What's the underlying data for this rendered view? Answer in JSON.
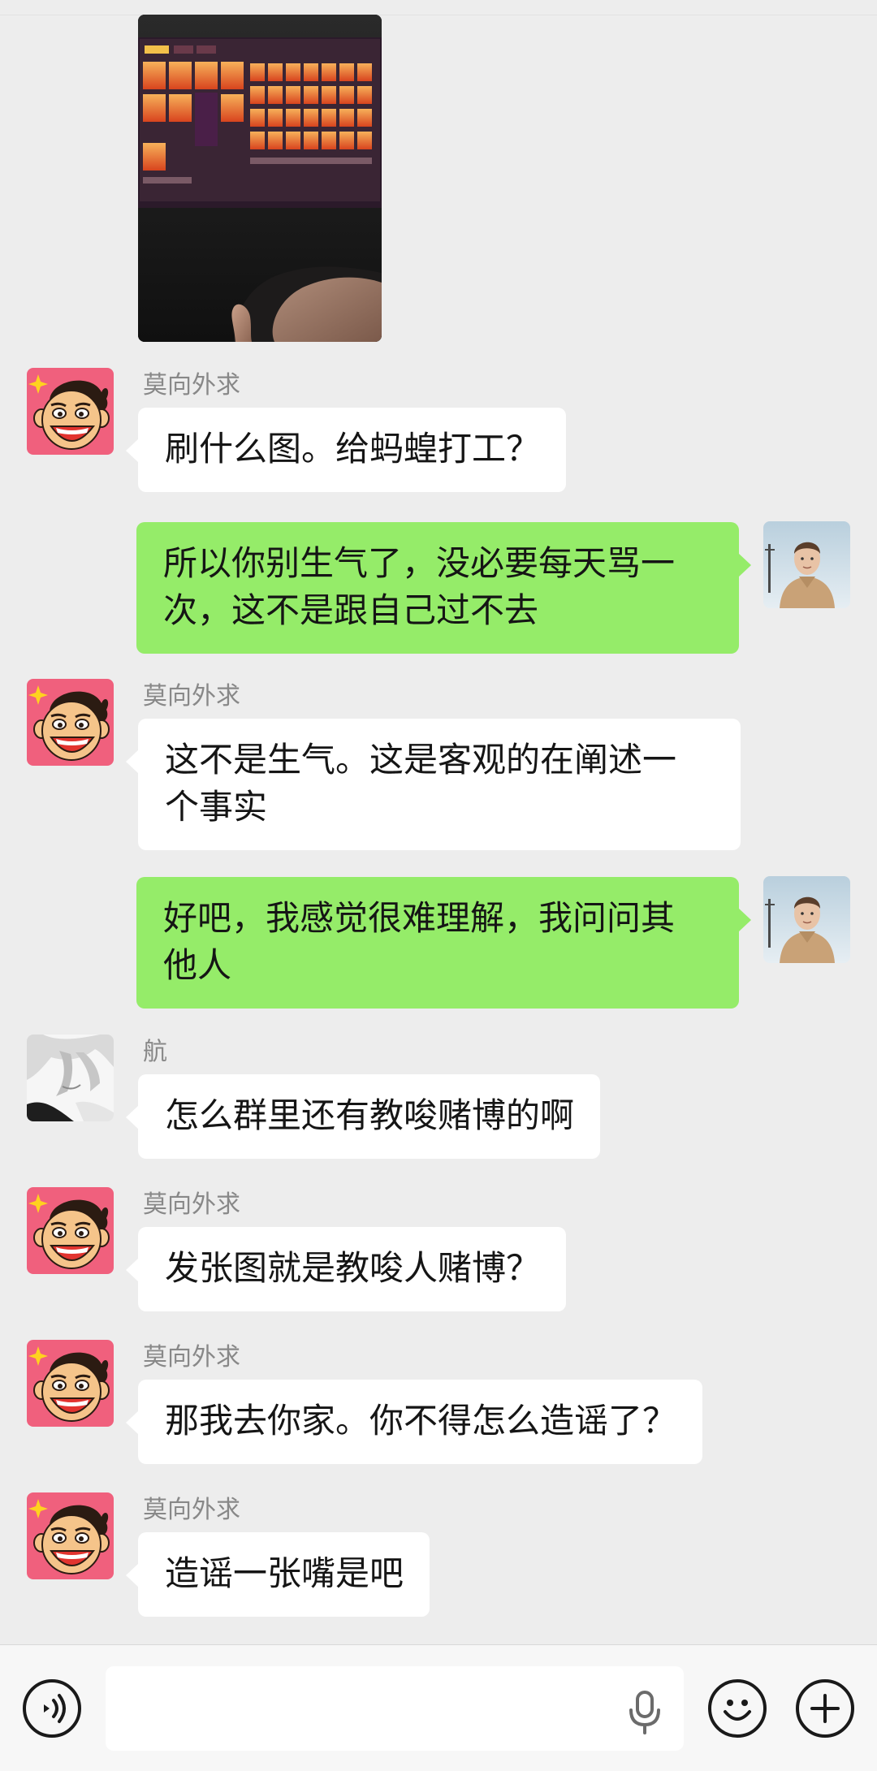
{
  "messages": [
    {
      "side": "left",
      "type": "image",
      "alt": "photo"
    },
    {
      "side": "left",
      "avatar": "monkey-avatar",
      "sender": "莫向外求",
      "text": "刷什么图。给蚂蝗打工？"
    },
    {
      "side": "right",
      "avatar": "self-avatar",
      "text": "所以你别生气了，没必要每天骂一\n次，这不是跟自己过不去"
    },
    {
      "side": "left",
      "avatar": "monkey-avatar",
      "sender": "莫向外求",
      "text": "这不是生气。这是客观的在阐述一\n个事实"
    },
    {
      "side": "right",
      "avatar": "self-avatar",
      "text": "好吧，我感觉很难理解，我问问其\n他人"
    },
    {
      "side": "left",
      "avatar": "anime-avatar",
      "sender": "航",
      "text": "怎么群里还有教唆赌博的啊"
    },
    {
      "side": "left",
      "avatar": "monkey-avatar",
      "sender": "莫向外求",
      "text": "发张图就是教唆人赌博？"
    },
    {
      "side": "left",
      "avatar": "monkey-avatar",
      "sender": "莫向外求",
      "text": "那我去你家。你不得怎么造谣了？"
    },
    {
      "side": "left",
      "avatar": "monkey-avatar",
      "sender": "莫向外求",
      "text": "造谣一张嘴是吧"
    }
  ],
  "input_bar": {
    "voice_icon": "voice-icon",
    "placeholder": "",
    "value": "",
    "mic_icon": "microphone-icon",
    "emoji_icon": "emoji-icon",
    "plus_icon": "plus-icon"
  },
  "colors": {
    "background": "#ededed",
    "bubble_incoming": "#ffffff",
    "bubble_outgoing": "#95ec69",
    "sender_name": "#888888",
    "avatar_monkey_bg": "#f0607d"
  }
}
